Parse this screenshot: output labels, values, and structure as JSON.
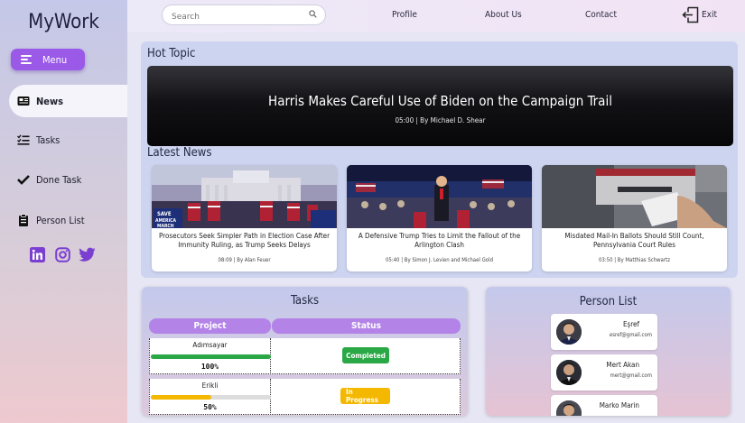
{
  "app": {
    "title": "MyWork"
  },
  "sidebar": {
    "menu_label": "Menu",
    "items": [
      {
        "label": "News",
        "icon": "newspaper-icon",
        "active": true
      },
      {
        "label": "Tasks",
        "icon": "task-list-icon",
        "active": false
      },
      {
        "label": "Done Task",
        "icon": "checkmark-icon",
        "active": false
      },
      {
        "label": "Person List",
        "icon": "clipboard-icon",
        "active": false
      }
    ],
    "socials": [
      "linkedin-icon",
      "instagram-icon",
      "twitter-icon"
    ]
  },
  "header": {
    "search_placeholder": "Search",
    "links": [
      "Profile",
      "About Us",
      "Contact"
    ],
    "exit_label": "Exit"
  },
  "colors": {
    "accent": "#9b59e8",
    "completed": "#2aa845",
    "in_progress": "#f5b800"
  },
  "hot_topic": {
    "section_title": "Hot Topic",
    "headline": "Harris Makes Careful Use of Biden on the Campaign Trail",
    "meta": "05:00 | By Michael D. Shear"
  },
  "latest_news": {
    "section_title": "Latest News",
    "articles": [
      {
        "title": "Prosecutors Seek Simpler Path in Election Case After Immunity Ruling, as Trump Seeks Delays",
        "meta": "08:09 | By Alan Feuer"
      },
      {
        "title": "A Defensive Trump Tries to Limit the Fallout of the Arlington Clash",
        "meta": "05:40 | By Simon J. Levien and Michael Gold"
      },
      {
        "title": "Misdated Mail-In Ballots Should Still Count, Pennsylvania Court Rules",
        "meta": "03:50 | By Matthias Schwartz"
      }
    ]
  },
  "tasks": {
    "title": "Tasks",
    "columns": [
      "Project",
      "Status"
    ],
    "rows": [
      {
        "project": "Adımsayar",
        "progress": 100,
        "progress_label": "100%",
        "status": "Completed"
      },
      {
        "project": "Erikli",
        "progress": 50,
        "progress_label": "50%",
        "status": "In Progress"
      }
    ]
  },
  "person_list": {
    "title": "Person List",
    "people": [
      {
        "name": "Eşref",
        "email": "esref@gmail.com"
      },
      {
        "name": "Mert Akan",
        "email": "mert@gmail.com"
      },
      {
        "name": "Marko Marin",
        "email": ""
      }
    ]
  }
}
